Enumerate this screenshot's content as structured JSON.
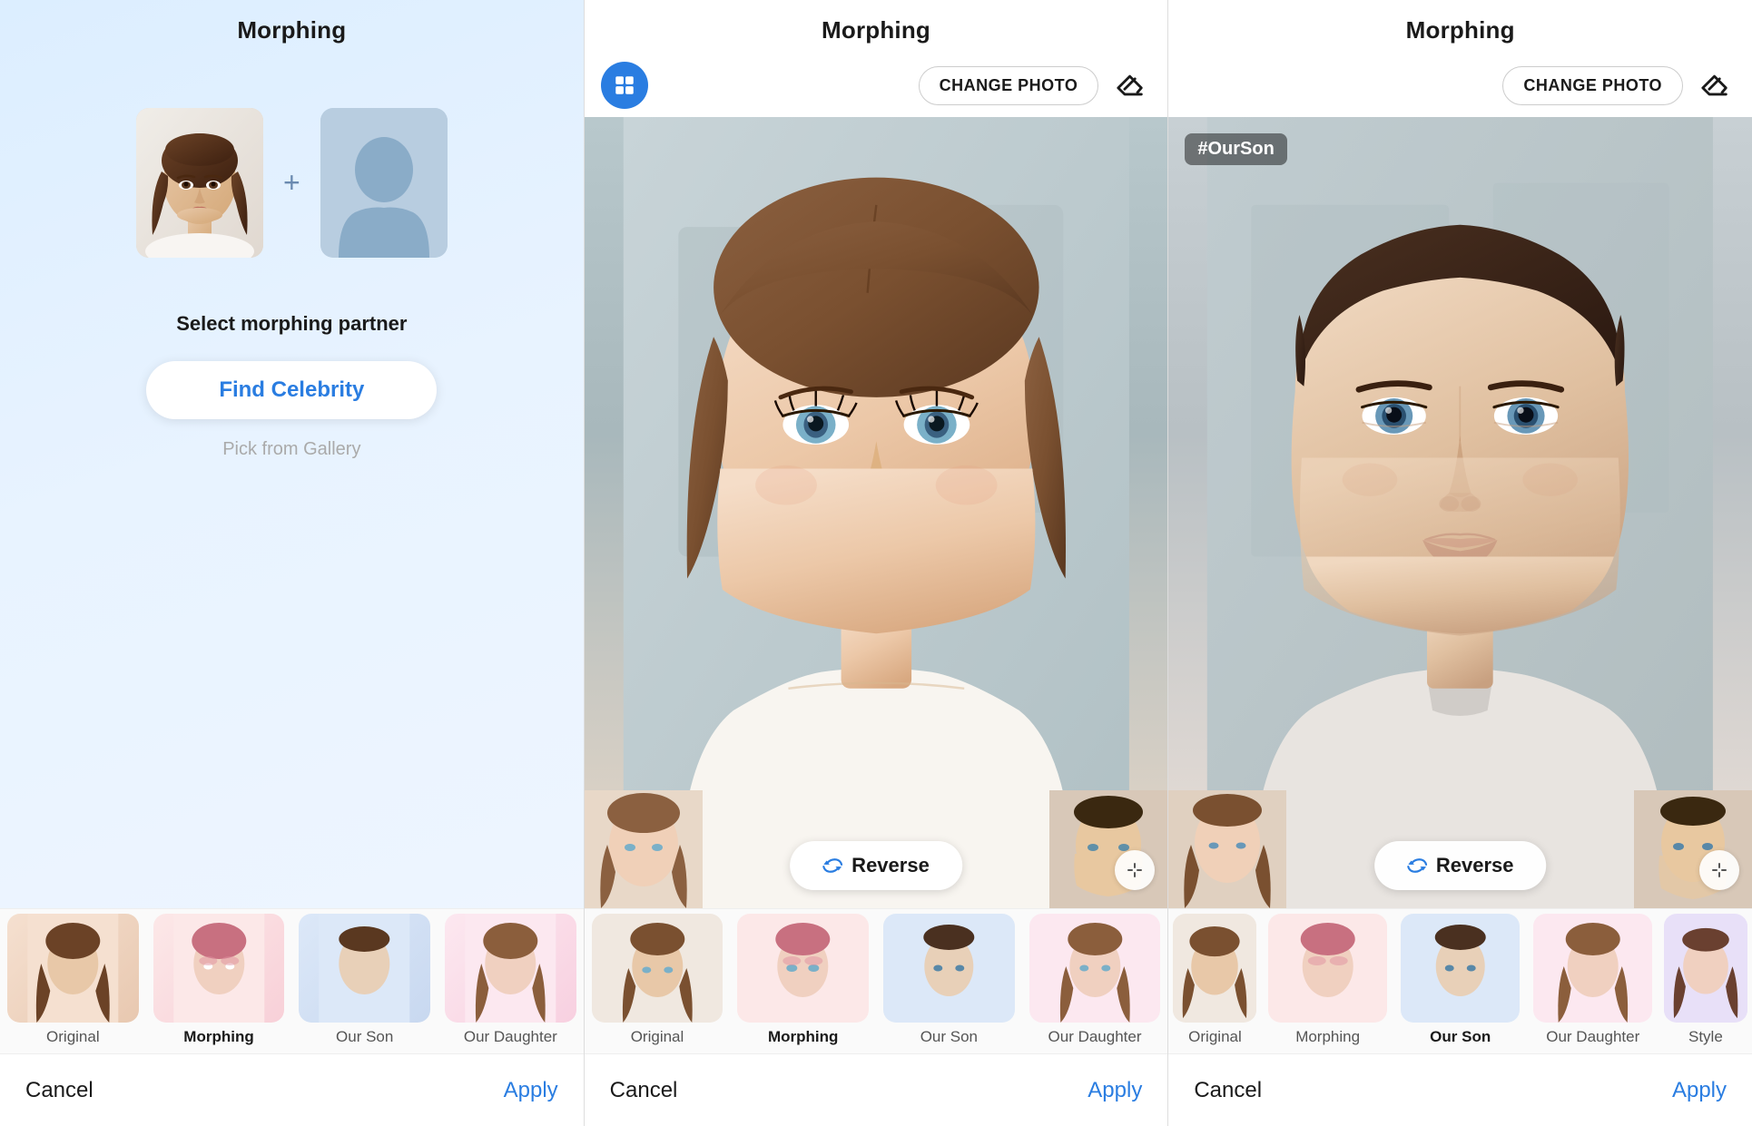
{
  "panels": [
    {
      "id": "panel1",
      "title": "Morphing",
      "select_text": "Select morphing partner",
      "find_celebrity_label": "Find Celebrity",
      "pick_gallery_label": "Pick from Gallery",
      "cancel_label": "Cancel",
      "apply_label": "Apply",
      "tabs": [
        {
          "id": "original",
          "label": "Original",
          "active": false,
          "color": "original"
        },
        {
          "id": "morphing",
          "label": "Morphing",
          "active": true,
          "color": "morphing"
        },
        {
          "id": "ourson",
          "label": "Our Son",
          "active": false,
          "color": "ourson"
        },
        {
          "id": "daughter",
          "label": "Our Daughter",
          "active": false,
          "color": "daughter"
        }
      ]
    },
    {
      "id": "panel2",
      "title": "Morphing",
      "change_photo_label": "CHANGE PHOTO",
      "reverse_label": "Reverse",
      "cancel_label": "Cancel",
      "apply_label": "Apply",
      "tabs": [
        {
          "id": "original",
          "label": "Original",
          "active": false,
          "color": "original"
        },
        {
          "id": "morphing",
          "label": "Morphing",
          "active": true,
          "color": "morphing"
        },
        {
          "id": "ourson",
          "label": "Our Son",
          "active": false,
          "color": "ourson"
        },
        {
          "id": "daughter",
          "label": "Our Daughter",
          "active": false,
          "color": "daughter"
        }
      ]
    },
    {
      "id": "panel3",
      "title": "Morphing",
      "change_photo_label": "CHANGE PHOTO",
      "reverse_label": "Reverse",
      "hashtag": "#OurSon",
      "cancel_label": "Cancel",
      "apply_label": "Apply",
      "tabs": [
        {
          "id": "original",
          "label": "Original",
          "active": false,
          "color": "original"
        },
        {
          "id": "morphing",
          "label": "Morphing",
          "active": false,
          "color": "morphing"
        },
        {
          "id": "ourson",
          "label": "Our Son",
          "active": true,
          "color": "ourson"
        },
        {
          "id": "daughter",
          "label": "Our Daughter",
          "active": false,
          "color": "daughter"
        },
        {
          "id": "style",
          "label": "Style",
          "active": false,
          "color": "style"
        }
      ]
    }
  ],
  "icons": {
    "grid": "grid-icon",
    "eraser": "eraser-icon",
    "reverse": "reverse-icon",
    "expand": "expand-icon"
  },
  "colors": {
    "brand_blue": "#2a7de1",
    "text_dark": "#1a1a1a",
    "text_gray": "#aaa",
    "bg_panel1": "#dceeff",
    "active_tab_color": "#1a1a1a"
  }
}
